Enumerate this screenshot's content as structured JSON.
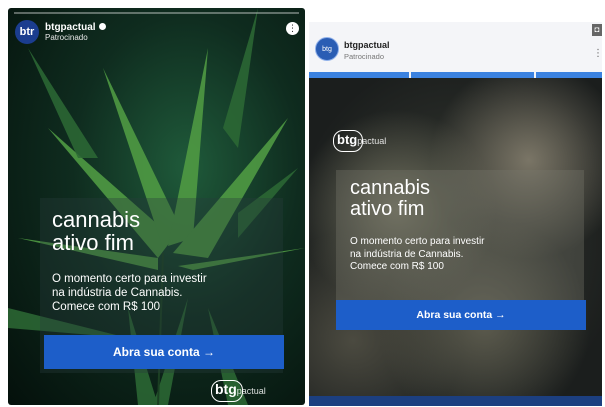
{
  "left_ad": {
    "avatar_text": "btr",
    "brand": "btgpactual",
    "sponsored": "Patrocinado",
    "more_glyph": "⋮",
    "headline_line1": "cannabis",
    "headline_line2": "ativo fim",
    "body_line1": "O momento certo para investir",
    "body_line2": "na indústria de Cannabis.",
    "body_line3": "Comece com R$ 100",
    "cta": "Abra sua conta →",
    "logo_bold": "btg",
    "logo_lite": "pactual",
    "colors": {
      "cta": "#1d5ec9",
      "background": "#0f2c1f",
      "leaf": "#4f9a43"
    }
  },
  "right_ad": {
    "avatar_text": "btg",
    "brand": "btgpactual",
    "sponsored": "Patrocinado",
    "more_glyph": "⋮",
    "corner_glyph": "◘",
    "logo_bold": "btg",
    "logo_lite": "pactual",
    "headline_line1": "cannabis",
    "headline_line2": "ativo fim",
    "body_line1": "O momento certo para investir",
    "body_line2": "na indústria de Cannabis.",
    "body_line3": "Comece com R$ 100",
    "cta": "Abra sua conta →",
    "colors": {
      "cta": "#1d5ec9",
      "accent": "#3b82e0",
      "header_bg": "#f4f5f8"
    }
  }
}
